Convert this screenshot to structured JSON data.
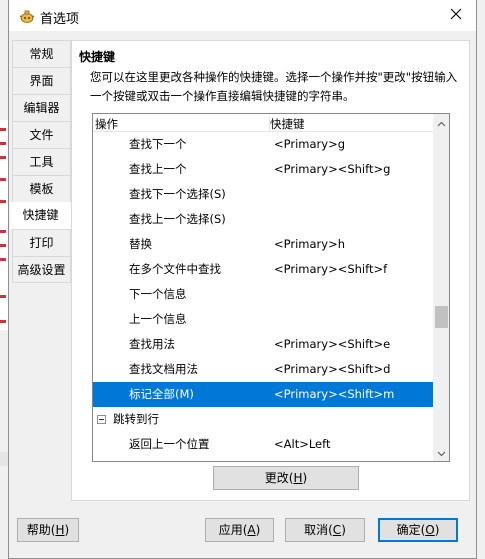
{
  "window": {
    "title": "首选项",
    "app_icon": "geany-teapot-icon",
    "close_icon": "close-icon"
  },
  "side_tabs": [
    {
      "label": "常规",
      "active": false
    },
    {
      "label": "界面",
      "active": false
    },
    {
      "label": "编辑器",
      "active": false
    },
    {
      "label": "文件",
      "active": false
    },
    {
      "label": "工具",
      "active": false
    },
    {
      "label": "模板",
      "active": false
    },
    {
      "label": "快捷键",
      "active": true
    },
    {
      "label": "打印",
      "active": false
    },
    {
      "label": "高级设置",
      "active": false
    }
  ],
  "panel": {
    "heading": "快捷键",
    "description": "您可以在这里更改各种操作的快捷键。选择一个操作并按\"更改\"按钮输入一个按键或双击一个操作直接编辑快捷键的字符串。"
  },
  "list": {
    "columns": {
      "action": "操作",
      "shortcut": "快捷键"
    },
    "rows": [
      {
        "action": "查找下一个",
        "shortcut": "<Primary>g",
        "selected": false,
        "group": false
      },
      {
        "action": "查找上一个",
        "shortcut": "<Primary><Shift>g",
        "selected": false,
        "group": false
      },
      {
        "action": "查找下一个选择(S)",
        "shortcut": "",
        "selected": false,
        "group": false
      },
      {
        "action": "查找上一个选择(S)",
        "shortcut": "",
        "selected": false,
        "group": false
      },
      {
        "action": "替换",
        "shortcut": "<Primary>h",
        "selected": false,
        "group": false
      },
      {
        "action": "在多个文件中查找",
        "shortcut": "<Primary><Shift>f",
        "selected": false,
        "group": false
      },
      {
        "action": "下一个信息",
        "shortcut": "",
        "selected": false,
        "group": false
      },
      {
        "action": "上一个信息",
        "shortcut": "",
        "selected": false,
        "group": false
      },
      {
        "action": "查找用法",
        "shortcut": "<Primary><Shift>e",
        "selected": false,
        "group": false
      },
      {
        "action": "查找文档用法",
        "shortcut": "<Primary><Shift>d",
        "selected": false,
        "group": false
      },
      {
        "action": "标记全部(M)",
        "shortcut": "<Primary><Shift>m",
        "selected": true,
        "group": false
      },
      {
        "action": "跳转到行",
        "shortcut": "",
        "selected": false,
        "group": true
      },
      {
        "action": "返回上一个位置",
        "shortcut": "<Alt>Left",
        "selected": false,
        "group": false
      }
    ],
    "scroll_position": 0.6
  },
  "buttons": {
    "change": {
      "label": "更改(",
      "key": "H",
      "tail": ")"
    },
    "help": {
      "label": "帮助(",
      "key": "H",
      "tail": ")"
    },
    "apply": {
      "label": "应用(",
      "key": "A",
      "tail": ")"
    },
    "cancel": {
      "label": "取消(",
      "key": "C",
      "tail": ")"
    },
    "ok": {
      "label": "确定(",
      "key": "O",
      "tail": ")"
    }
  },
  "colors": {
    "selection": "#0078d7",
    "window_bg": "#f0f0f0",
    "panel_bg": "#ffffff"
  }
}
